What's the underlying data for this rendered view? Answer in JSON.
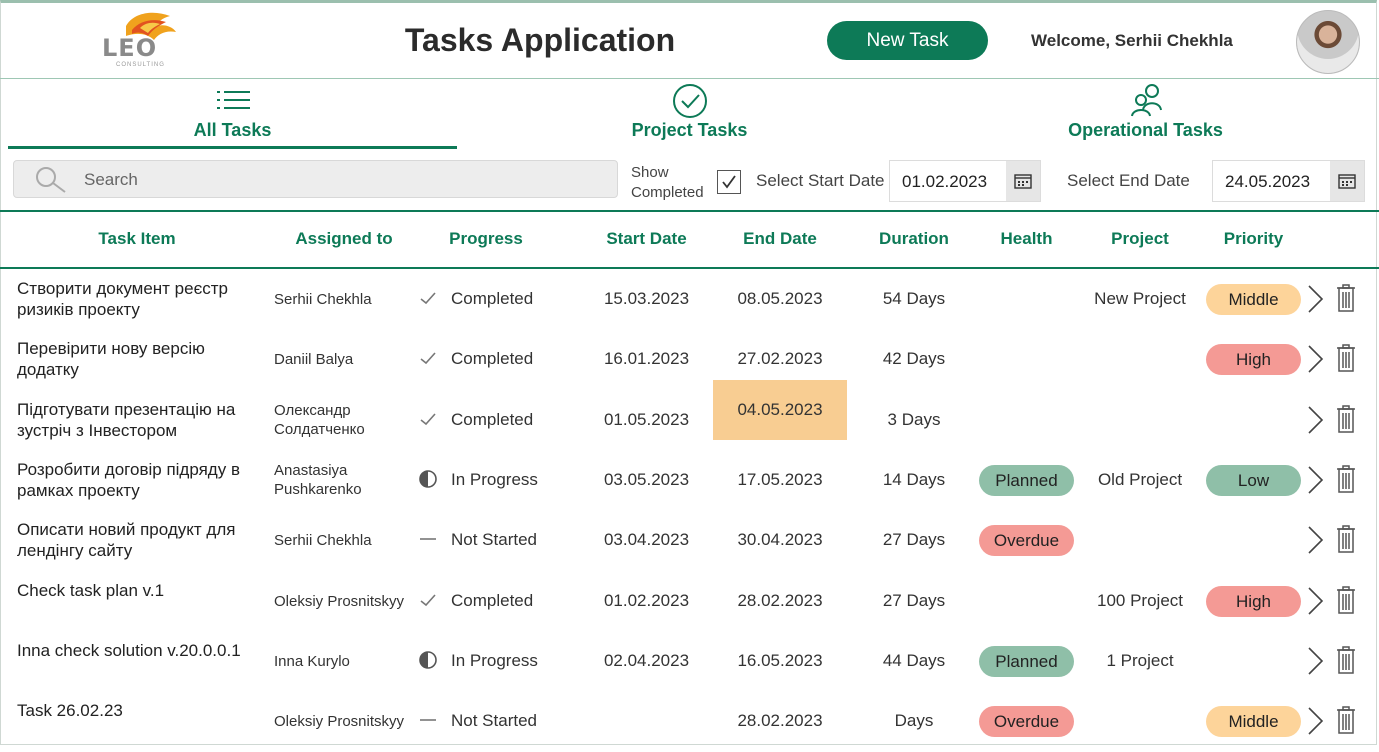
{
  "header": {
    "logo_text": "LEO",
    "logo_subtext": "CONSULTING",
    "title": "Tasks Application",
    "new_task_label": "New Task",
    "welcome": "Welcome, Serhii Chekhla"
  },
  "tabs": [
    {
      "label": "All Tasks",
      "icon": "list-icon",
      "active": true
    },
    {
      "label": "Project Tasks",
      "icon": "check-circle-icon",
      "active": false
    },
    {
      "label": "Operational Tasks",
      "icon": "people-icon",
      "active": false
    }
  ],
  "filters": {
    "search_placeholder": "Search",
    "search_value": "",
    "show_completed_line1": "Show",
    "show_completed_line2": "Completed",
    "show_completed_checked": true,
    "start_label": "Select Start Date",
    "start_value": "01.02.2023",
    "end_label": "Select End Date",
    "end_value": "24.05.2023"
  },
  "columns": [
    "Task Item",
    "Assigned to",
    "Progress",
    "Start Date",
    "End Date",
    "Duration",
    "Health",
    "Project",
    "Priority"
  ],
  "colors": {
    "accent": "#0d7a57",
    "planned": "#8fbfa8",
    "overdue": "#f49a95",
    "middle": "#fdd49a",
    "high": "#f49a95",
    "low": "#8fbfa8",
    "highlight": "#f8cd92"
  },
  "rows": [
    {
      "task": "Створити документ реєстр ризиків проекту",
      "assignee": "Serhii Chekhla",
      "progress_icon": "check-icon",
      "progress": "Completed",
      "start": "15.03.2023",
      "end": "08.05.2023",
      "end_highlight": false,
      "duration": "54 Days",
      "health": "",
      "project": "New Project",
      "priority": "Middle"
    },
    {
      "task": "Перевірити нову версію додатку",
      "assignee": "Daniil  Balya",
      "progress_icon": "check-icon",
      "progress": "Completed",
      "start": "16.01.2023",
      "end": "27.02.2023",
      "end_highlight": false,
      "duration": "42 Days",
      "health": "",
      "project": "",
      "priority": "High"
    },
    {
      "task": "Підготувати презентацію на зустріч з Інвестором",
      "assignee": "Олександр Солдатченко",
      "progress_icon": "check-icon",
      "progress": "Completed",
      "start": "01.05.2023",
      "end": "04.05.2023",
      "end_highlight": true,
      "duration": "3 Days",
      "health": "",
      "project": "",
      "priority": ""
    },
    {
      "task": "Розробити договір підряду в рамках проекту",
      "assignee": "Anastasiya Pushkarenko",
      "progress_icon": "half-circle-icon",
      "progress": "In Progress",
      "start": "03.05.2023",
      "end": "17.05.2023",
      "end_highlight": false,
      "duration": "14 Days",
      "health": "Planned",
      "project": "Old Project",
      "priority": "Low"
    },
    {
      "task": "Описати новий продукт для лендінгу сайту",
      "assignee": "Serhii Chekhla",
      "progress_icon": "dash-icon",
      "progress": "Not Started",
      "start": "03.04.2023",
      "end": "30.04.2023",
      "end_highlight": false,
      "duration": "27 Days",
      "health": "Overdue",
      "project": "",
      "priority": ""
    },
    {
      "task": "Check task plan v.1",
      "assignee": "Oleksiy Prosnitskyy",
      "progress_icon": "check-icon",
      "progress": "Completed",
      "start": "01.02.2023",
      "end": "28.02.2023",
      "end_highlight": false,
      "duration": "27 Days",
      "health": "",
      "project": "100 Project",
      "priority": "High"
    },
    {
      "task": "Inna check solution v.20.0.0.1",
      "assignee": "Inna Kurylo",
      "progress_icon": "half-circle-icon",
      "progress": "In Progress",
      "start": "02.04.2023",
      "end": "16.05.2023",
      "end_highlight": false,
      "duration": "44 Days",
      "health": "Planned",
      "project": "1 Project",
      "priority": ""
    },
    {
      "task": "Task 26.02.23",
      "assignee": "Oleksiy Prosnitskyy",
      "progress_icon": "dash-icon",
      "progress": "Not Started",
      "start": "",
      "end": "28.02.2023",
      "end_highlight": false,
      "duration": "Days",
      "health": "Overdue",
      "project": "",
      "priority": "Middle"
    }
  ]
}
